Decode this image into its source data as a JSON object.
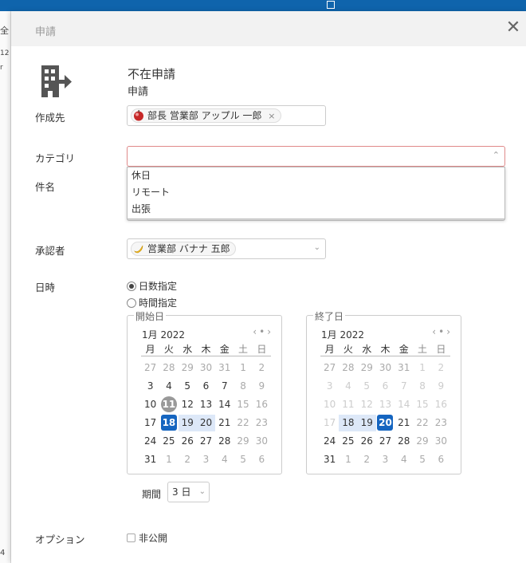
{
  "background": {
    "left_texts": [
      "全",
      "12",
      "r",
      "4"
    ]
  },
  "modal": {
    "header_title": "申請",
    "close_label": "✕"
  },
  "app": {
    "title": "不在申請",
    "subtitle": "申請"
  },
  "labels": {
    "creator": "作成先",
    "category": "カテゴリ",
    "subject": "件名",
    "approver": "承認者",
    "datetime": "日時",
    "options": "オプション",
    "period": "期間"
  },
  "creator": {
    "name": "部長 営業部 アップル 一郎",
    "remove": "×"
  },
  "category": {
    "value": "",
    "caret": "⌃",
    "options": [
      "休日",
      "リモート",
      "出張"
    ]
  },
  "approver": {
    "name": "営業部 バナナ 五郎"
  },
  "datetime": {
    "radio_days": "日数指定",
    "radio_time": "時間指定",
    "selected": "日数指定"
  },
  "calendar_start": {
    "legend": "開始日",
    "month": "1月 2022",
    "weekdays": [
      "月",
      "火",
      "水",
      "木",
      "金",
      "土",
      "日"
    ],
    "weeks": [
      [
        "27",
        "28",
        "29",
        "30",
        "31",
        "1",
        "2"
      ],
      [
        "3",
        "4",
        "5",
        "6",
        "7",
        "8",
        "9"
      ],
      [
        "10",
        "11",
        "12",
        "13",
        "14",
        "15",
        "16"
      ],
      [
        "17",
        "18",
        "19",
        "20",
        "21",
        "22",
        "23"
      ],
      [
        "24",
        "25",
        "26",
        "27",
        "28",
        "29",
        "30"
      ],
      [
        "31",
        "1",
        "2",
        "3",
        "4",
        "5",
        "6"
      ]
    ],
    "today": "11",
    "selected": "18",
    "range": [
      "19",
      "20"
    ]
  },
  "calendar_end": {
    "legend": "終了日",
    "month": "1月 2022",
    "weekdays": [
      "月",
      "火",
      "水",
      "木",
      "金",
      "土",
      "日"
    ],
    "weeks": [
      [
        "27",
        "28",
        "29",
        "30",
        "31",
        "1",
        "2"
      ],
      [
        "3",
        "4",
        "5",
        "6",
        "7",
        "8",
        "9"
      ],
      [
        "10",
        "11",
        "12",
        "13",
        "14",
        "15",
        "16"
      ],
      [
        "17",
        "18",
        "19",
        "20",
        "21",
        "22",
        "23"
      ],
      [
        "24",
        "25",
        "26",
        "27",
        "28",
        "29",
        "30"
      ],
      [
        "31",
        "1",
        "2",
        "3",
        "4",
        "5",
        "6"
      ]
    ],
    "selected": "20",
    "range": [
      "18",
      "19"
    ]
  },
  "period": {
    "value": "3 日"
  },
  "options": {
    "private_label": "非公開",
    "private_checked": false
  },
  "colors": {
    "accent": "#1565c0",
    "range": "#dde8f8",
    "topbar": "#0f64ac"
  }
}
